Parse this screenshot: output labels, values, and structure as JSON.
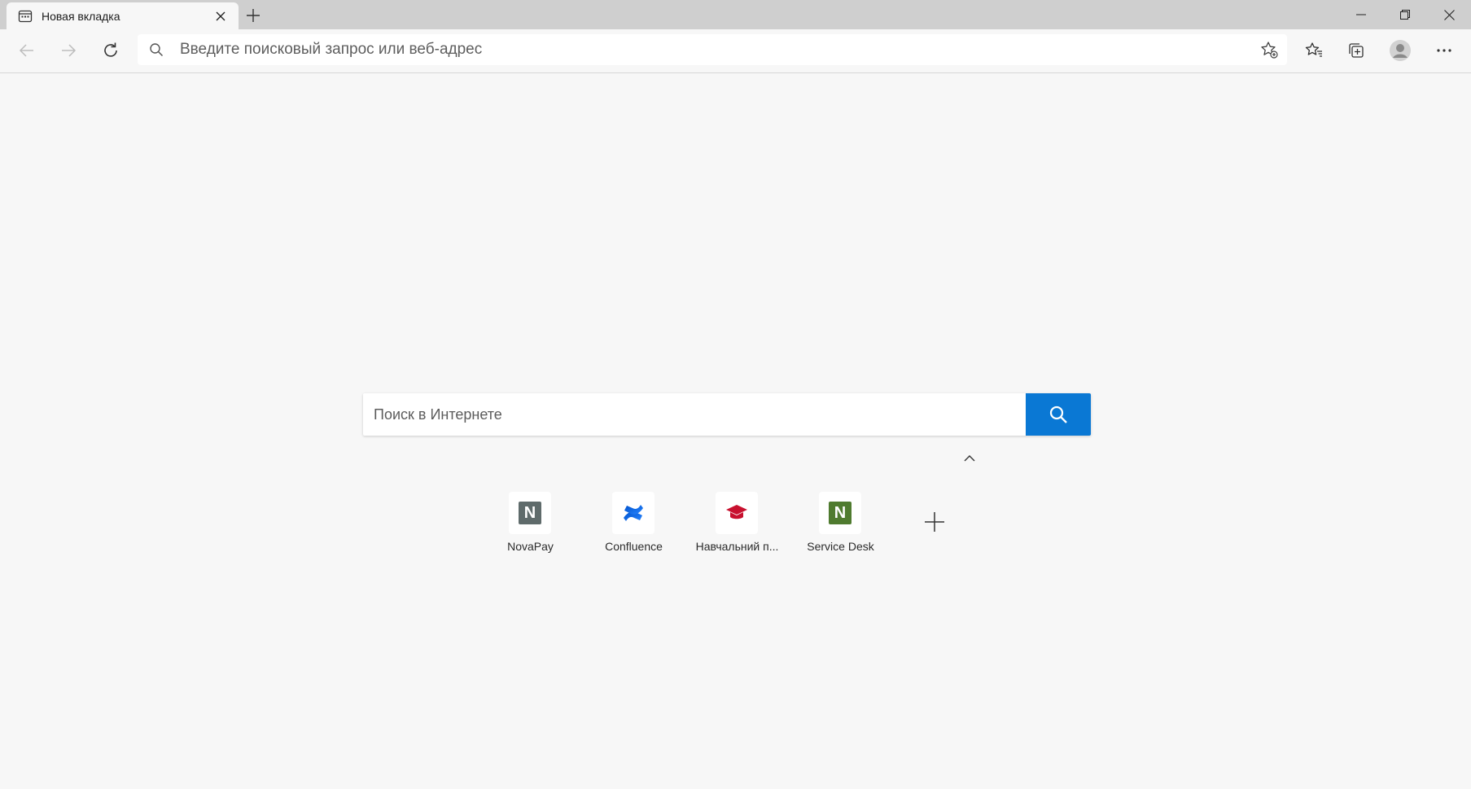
{
  "tab": {
    "title": "Новая вкладка"
  },
  "address_bar": {
    "placeholder": "Введите поисковый запрос или веб-адрес"
  },
  "search": {
    "placeholder": "Поиск в Интернете"
  },
  "quick_links": [
    {
      "label": "NovaPay",
      "icon": "novapay-n-icon",
      "color": "#5f6b6b",
      "letter": "N"
    },
    {
      "label": "Confluence",
      "icon": "confluence-icon",
      "color": "#2684ff"
    },
    {
      "label": "Навчальний п...",
      "icon": "graduation-cap-icon",
      "color": "#c8102e"
    },
    {
      "label": "Service Desk",
      "icon": "service-desk-n-icon",
      "color": "#4f7b2f",
      "letter": "N"
    }
  ],
  "colors": {
    "accent": "#0a78d4",
    "tabstrip": "#cfcfcf",
    "page_bg": "#f7f7f7"
  }
}
